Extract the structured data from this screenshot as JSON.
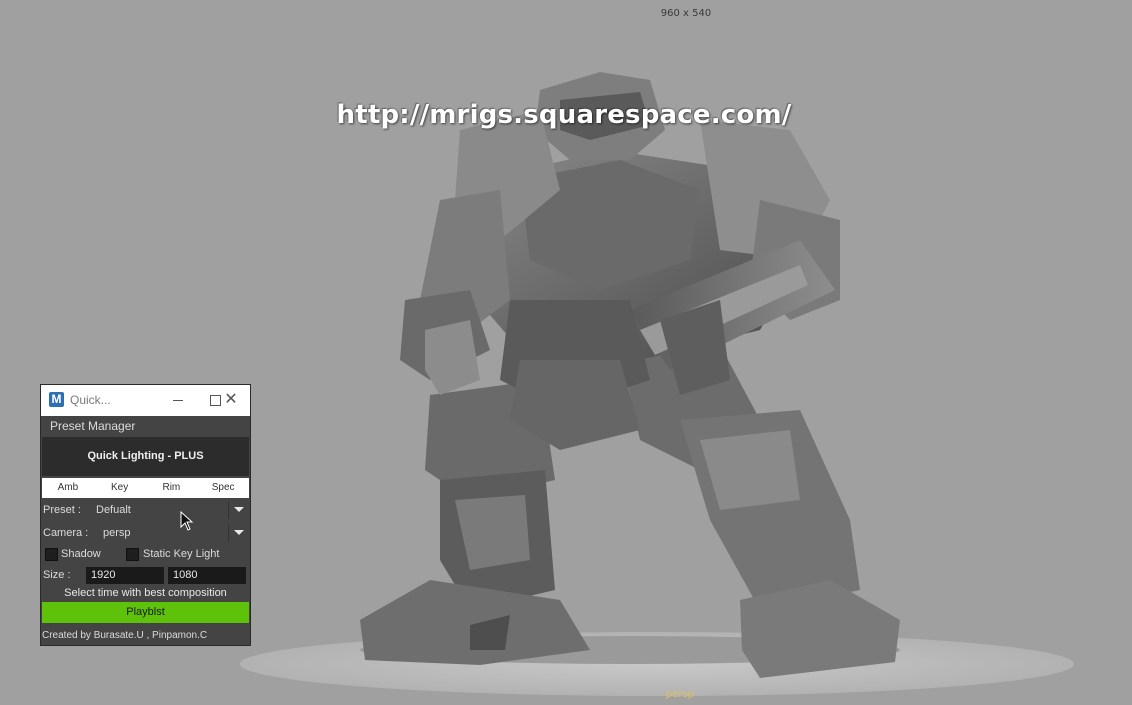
{
  "viewport": {
    "resolution_label": "960 x 540",
    "watermark": "http://mrigs.squarespace.com/",
    "camera_label": "persp",
    "background_color": "#a0a0a0"
  },
  "window": {
    "title": "Quick...",
    "icon_letter": "M",
    "menu": "Preset Manager",
    "header": "Quick Lighting - PLUS",
    "tabs": [
      "Amb",
      "Key",
      "Rim",
      "Spec"
    ],
    "preset": {
      "label": "Preset :",
      "value": "Defualt"
    },
    "camera": {
      "label": "Camera :",
      "value": "persp"
    },
    "shadow_label": "Shadow",
    "static_key_label": "Static Key Light",
    "size": {
      "label": "Size :",
      "width": "1920",
      "height": "1080"
    },
    "hint": "Select time with best composition",
    "playblast_label": "Playblst",
    "credits": "Created by Burasate.U , Pinpamon.C",
    "playblast_color": "#5ec10a"
  }
}
